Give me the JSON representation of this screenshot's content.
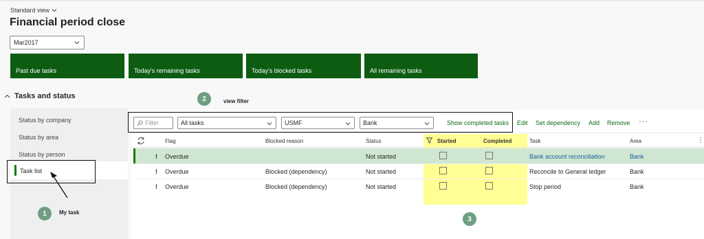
{
  "header": {
    "view_name": "Standard view",
    "page_title": "Financial period close",
    "period_value": "Mar2017"
  },
  "tiles": [
    {
      "label": "Past due tasks"
    },
    {
      "label": "Today's remaining tasks"
    },
    {
      "label": "Today's blocked tasks"
    },
    {
      "label": "All remaining tasks"
    }
  ],
  "section": {
    "title": "Tasks and status"
  },
  "sidebar": {
    "items": [
      {
        "label": "Status by company"
      },
      {
        "label": "Status by area"
      },
      {
        "label": "Status by person"
      },
      {
        "label": "Task list"
      }
    ]
  },
  "annotations": {
    "badge1": "1",
    "badge1_text": "My task",
    "badge2": "2",
    "badge2_text": "view filter",
    "badge3": "3"
  },
  "filters": {
    "filter_placeholder": "Filter",
    "tasks_value": "All tasks",
    "company_value": "USMF",
    "area_value": "Bank"
  },
  "actions": {
    "show_completed": "Show completed tasks",
    "edit": "Edit",
    "set_dependency": "Set dependency",
    "add": "Add",
    "remove": "Remove",
    "more": "···"
  },
  "grid": {
    "headers": {
      "flag": "Flag",
      "blocked_reason": "Blocked reason",
      "status": "Status",
      "started": "Started",
      "completed": "Completed",
      "task": "Task",
      "area": "Area"
    },
    "rows": [
      {
        "mark": "!",
        "flag": "Overdue",
        "blocked_reason": "",
        "status": "Not started",
        "task": "Bank account reconciliation",
        "area": "Bank"
      },
      {
        "mark": "!",
        "flag": "Overdue",
        "blocked_reason": "Blocked (dependency)",
        "status": "Not started",
        "task": "Reconcile to General ledger",
        "area": "Bank"
      },
      {
        "mark": "!",
        "flag": "Overdue",
        "blocked_reason": "Blocked (dependency)",
        "status": "Not started",
        "task": "Stop period",
        "area": "Bank"
      }
    ]
  },
  "colors": {
    "tile_green": "#0d5c12",
    "accent_green": "#107c10",
    "selected_row": "#cfe6d1",
    "highlight_yellow": "#ffff3c",
    "badge_green": "#6f9e83",
    "link_blue": "#1c5f9e"
  }
}
